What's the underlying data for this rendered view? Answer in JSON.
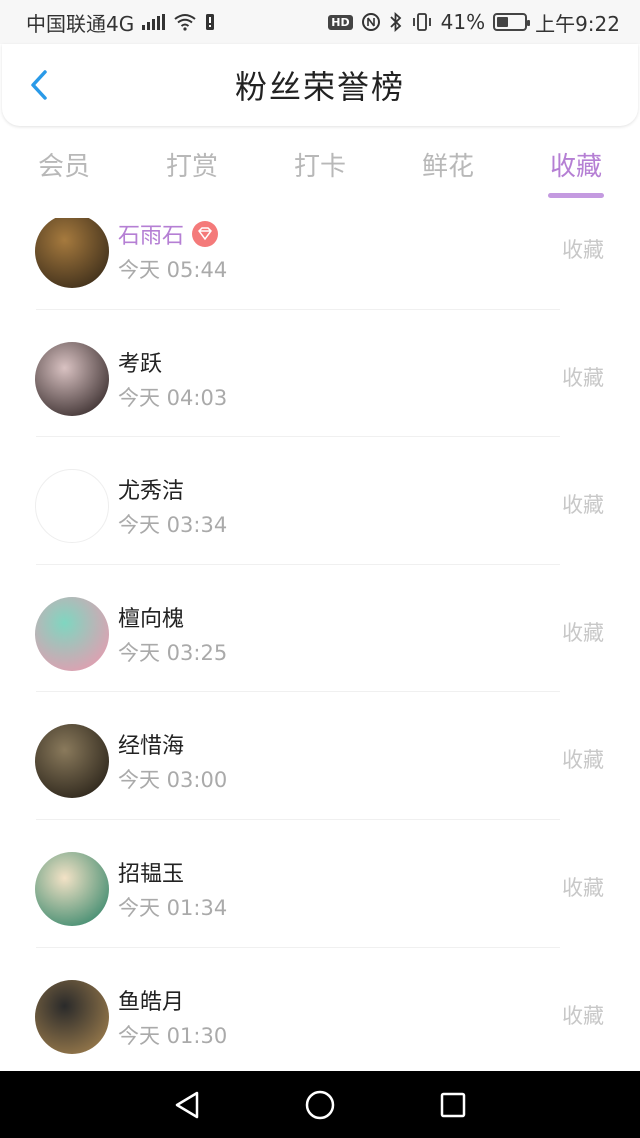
{
  "status_bar": {
    "carrier": "中国联通4G",
    "network_small": "4G",
    "battery_percent": "41%",
    "battery_level": 0.41,
    "time": "上午9:22",
    "hd_label": "HD",
    "icons": [
      "signal-icon",
      "wifi-icon",
      "notification-icon",
      "hd-icon",
      "nfc-icon",
      "bluetooth-icon",
      "vibrate-icon",
      "battery-icon"
    ]
  },
  "header": {
    "title": "粉丝荣誉榜",
    "back_icon": "chevron-left-icon"
  },
  "tabs": [
    {
      "label": "会员",
      "active": false
    },
    {
      "label": "打赏",
      "active": false
    },
    {
      "label": "打卡",
      "active": false
    },
    {
      "label": "鲜花",
      "active": false
    },
    {
      "label": "收藏",
      "active": true
    }
  ],
  "list": [
    {
      "name": "石雨石",
      "time": "今天 05:44",
      "action": "收藏",
      "vip": true,
      "avatar_colors": [
        "#a67a3e",
        "#3c2d1a"
      ]
    },
    {
      "name": "考跃",
      "time": "今天 04:03",
      "action": "收藏",
      "vip": false,
      "avatar_colors": [
        "#d9c2c2",
        "#3a2e2e"
      ]
    },
    {
      "name": "尤秀洁",
      "time": "今天 03:34",
      "action": "收藏",
      "vip": false,
      "avatar_colors": [
        "#ffffff",
        "#111111"
      ]
    },
    {
      "name": "檀向槐",
      "time": "今天 03:25",
      "action": "收藏",
      "vip": false,
      "avatar_colors": [
        "#7fd6c0",
        "#e59cb0"
      ]
    },
    {
      "name": "经惜海",
      "time": "今天 03:00",
      "action": "收藏",
      "vip": false,
      "avatar_colors": [
        "#8a7a5c",
        "#2b241a"
      ]
    },
    {
      "name": "招韫玉",
      "time": "今天 01:34",
      "action": "收藏",
      "vip": false,
      "avatar_colors": [
        "#f3e2c6",
        "#3d8a6e"
      ]
    },
    {
      "name": "鱼皓月",
      "time": "今天 01:30",
      "action": "收藏",
      "vip": false,
      "avatar_colors": [
        "#2a2a2a",
        "#9a7b4c"
      ]
    }
  ],
  "colors": {
    "accent": "#b57fd4",
    "muted": "#aaaaaa",
    "action": "#c8c8c8",
    "vip_badge": "#f47a7a"
  },
  "nav_bar": {
    "icons": [
      "back-triangle-icon",
      "home-circle-icon",
      "recents-square-icon"
    ]
  }
}
